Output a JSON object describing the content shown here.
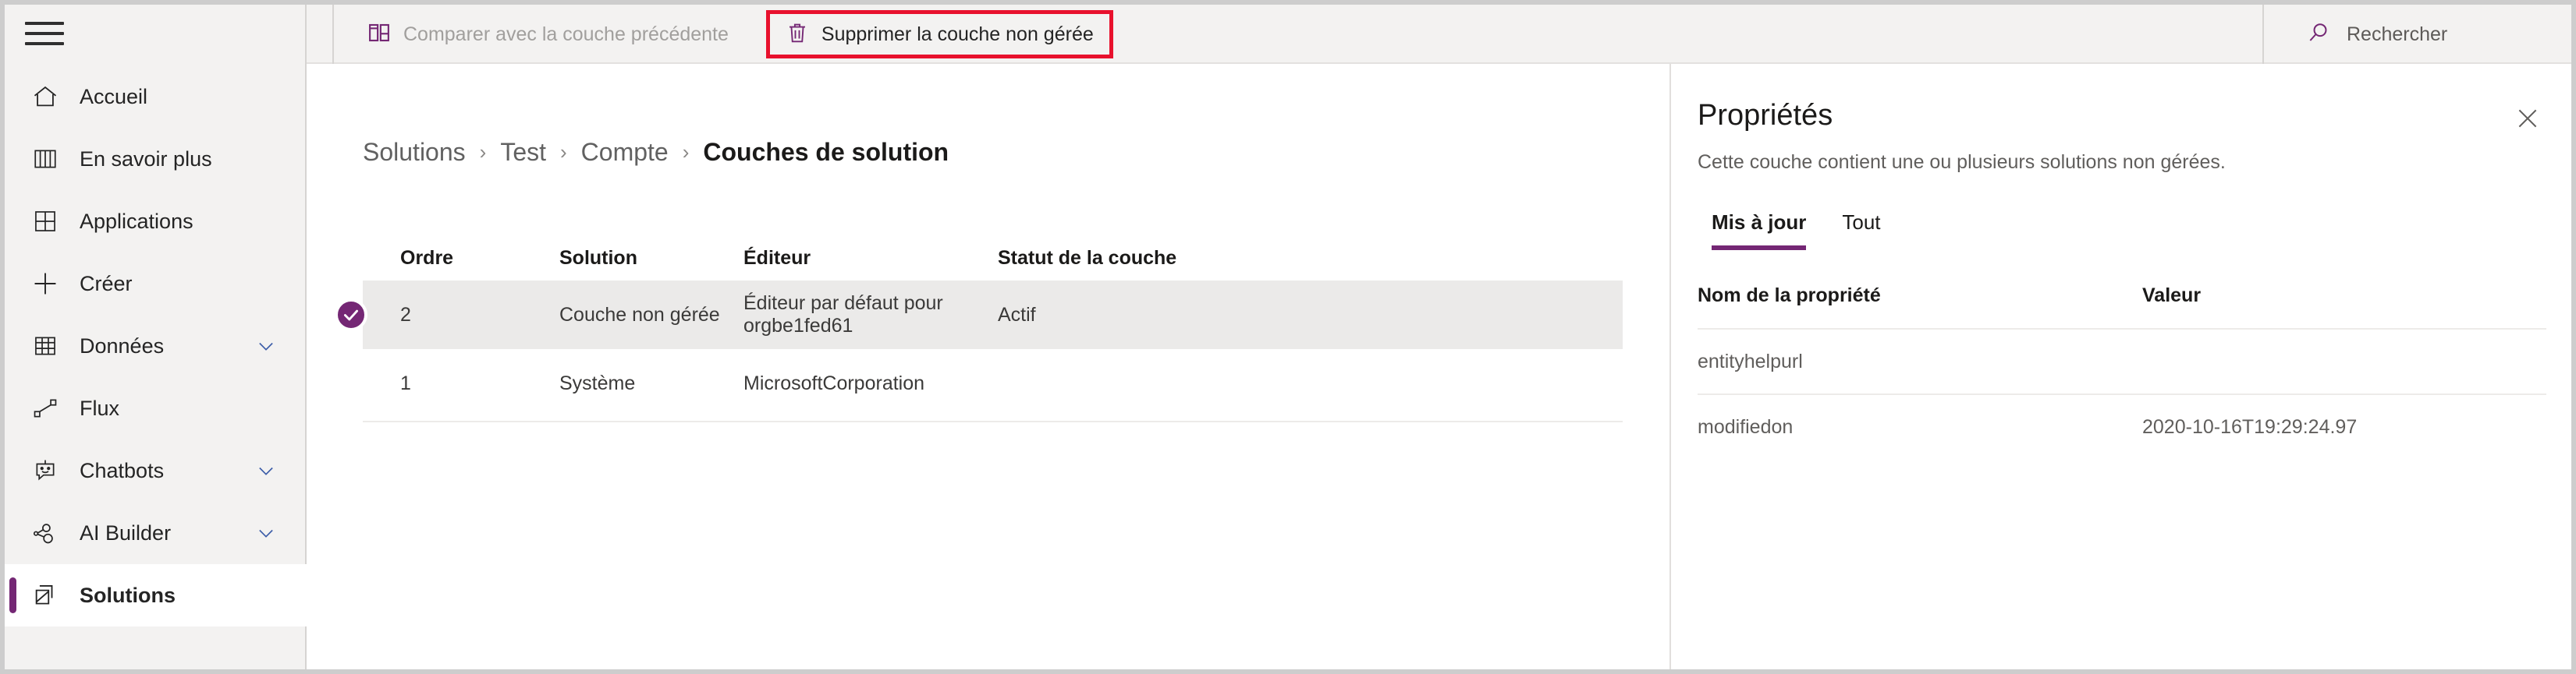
{
  "sidebar": {
    "menu_icon": "hamburger-icon",
    "items": [
      {
        "label": "Accueil",
        "icon": "home-icon",
        "chevron": false,
        "active": false
      },
      {
        "label": "En savoir plus",
        "icon": "book-icon",
        "chevron": false,
        "active": false
      },
      {
        "label": "Applications",
        "icon": "apps-grid-icon",
        "chevron": false,
        "active": false
      },
      {
        "label": "Créer",
        "icon": "plus-icon",
        "chevron": false,
        "active": false
      },
      {
        "label": "Données",
        "icon": "table-icon",
        "chevron": true,
        "active": false
      },
      {
        "label": "Flux",
        "icon": "flow-icon",
        "chevron": false,
        "active": false
      },
      {
        "label": "Chatbots",
        "icon": "robot-icon",
        "chevron": true,
        "active": false
      },
      {
        "label": "AI Builder",
        "icon": "ai-builder-icon",
        "chevron": true,
        "active": false
      },
      {
        "label": "Solutions",
        "icon": "solutions-icon",
        "chevron": false,
        "active": true
      }
    ]
  },
  "toolbar": {
    "compare_label": "Comparer avec la couche précédente",
    "compare_icon": "compare-layers-icon",
    "delete_label": "Supprimer la couche non gérée",
    "delete_icon": "trash-icon",
    "highlight_color": "#e8112d"
  },
  "search": {
    "label": "Rechercher",
    "icon": "search-icon"
  },
  "breadcrumb": {
    "items": [
      "Solutions",
      "Test",
      "Compte",
      "Couches de solution"
    ],
    "separator": "›"
  },
  "grid": {
    "columns": [
      "Ordre",
      "Solution",
      "Éditeur",
      "Statut de la couche"
    ],
    "rows": [
      {
        "selected": true,
        "check_icon": "check-circle-icon",
        "ordre": "2",
        "solution": "Couche non gérée",
        "editeur": "Éditeur par défaut pour orgbe1fed61",
        "statut": "Actif"
      },
      {
        "selected": false,
        "check_icon": "",
        "ordre": "1",
        "solution": "Système",
        "editeur": "MicrosoftCorporation",
        "statut": ""
      }
    ]
  },
  "panel": {
    "title": "Propriétés",
    "subtitle": "Cette couche contient une ou plusieurs solutions non gérées.",
    "close_icon": "close-icon",
    "tabs": [
      {
        "label": "Mis à jour",
        "active": true
      },
      {
        "label": "Tout",
        "active": false
      }
    ],
    "table": {
      "columns": [
        "Nom de la propriété",
        "Valeur"
      ],
      "rows": [
        {
          "name": "entityhelpurl",
          "value": ""
        },
        {
          "name": "modifiedon",
          "value": "2020-10-16T19:29:24.97"
        }
      ]
    }
  },
  "colors": {
    "accent_purple": "#742774",
    "sidebar_bg": "#f3f2f1",
    "selected_row": "#ebeae9",
    "alert_red": "#e8112d"
  }
}
